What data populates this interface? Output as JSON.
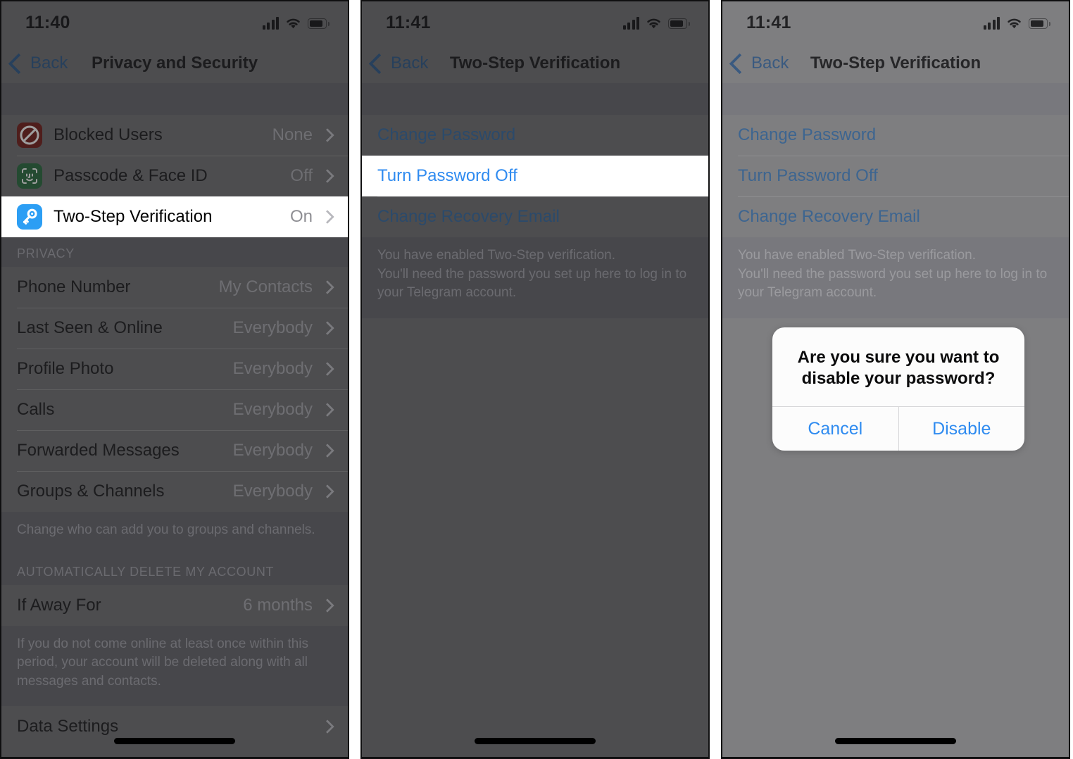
{
  "panels": [
    {
      "id": "privacy-and-security",
      "status_bar": {
        "time": "11:40",
        "cellular": "signal-bars-icon",
        "wifi": "wifi-icon",
        "battery": "battery-icon"
      },
      "nav": {
        "back_label": "Back",
        "title": "Privacy and Security"
      },
      "security_rows": [
        {
          "icon": "blocked-users-icon",
          "label": "Blocked Users",
          "value": "None"
        },
        {
          "icon": "face-id-icon",
          "label": "Passcode & Face ID",
          "value": "Off"
        },
        {
          "icon": "two-step-verification-key-icon",
          "label": "Two-Step Verification",
          "value": "On",
          "highlighted": true
        }
      ],
      "privacy_header": "PRIVACY",
      "privacy_rows": [
        {
          "label": "Phone Number",
          "value": "My Contacts"
        },
        {
          "label": "Last Seen & Online",
          "value": "Everybody"
        },
        {
          "label": "Profile Photo",
          "value": "Everybody"
        },
        {
          "label": "Calls",
          "value": "Everybody"
        },
        {
          "label": "Forwarded Messages",
          "value": "Everybody"
        },
        {
          "label": "Groups & Channels",
          "value": "Everybody"
        }
      ],
      "privacy_footer": "Change who can add you to groups and channels.",
      "delete_header": "AUTOMATICALLY DELETE MY ACCOUNT",
      "delete_rows": [
        {
          "label": "If Away For",
          "value": "6 months"
        }
      ],
      "delete_footer": "If you do not come online at least once within this period, your account will be deleted along with all messages and contacts.",
      "data_rows": [
        {
          "label": "Data Settings",
          "value": ""
        }
      ]
    },
    {
      "id": "two-step-verification",
      "status_bar": {
        "time": "11:41",
        "cellular": "signal-bars-icon",
        "wifi": "wifi-icon",
        "battery": "battery-icon"
      },
      "nav": {
        "back_label": "Back",
        "title": "Two-Step Verification"
      },
      "links": [
        {
          "label": "Change Password",
          "highlighted": false
        },
        {
          "label": "Turn Password Off",
          "highlighted": true
        },
        {
          "label": "Change Recovery Email",
          "highlighted": false
        }
      ],
      "footer": "You have enabled Two-Step verification.\nYou'll need the password you set up here to log in to your Telegram account."
    },
    {
      "id": "two-step-verification-confirm",
      "status_bar": {
        "time": "11:41",
        "cellular": "signal-bars-icon",
        "wifi": "wifi-icon",
        "battery": "battery-icon"
      },
      "nav": {
        "back_label": "Back",
        "title": "Two-Step Verification"
      },
      "links": [
        {
          "label": "Change Password",
          "highlighted": false
        },
        {
          "label": "Turn Password Off",
          "highlighted": false
        },
        {
          "label": "Change Recovery Email",
          "highlighted": false
        }
      ],
      "footer": "You have enabled Two-Step verification.\nYou'll need the password you set up here to log in to your Telegram account.",
      "alert": {
        "title": "Are you sure you want to disable your password?",
        "cancel_label": "Cancel",
        "confirm_label": "Disable"
      }
    }
  ],
  "colors": {
    "accent_blue": "#2f8bf0",
    "highlight_white": "#ffffff",
    "blocked_icon_red": "#b3231e",
    "face_id_icon_green": "#14843c",
    "key_icon_blue": "#2c9ef4",
    "dim_dark": "#4d4d4f",
    "dim_light": "#7e7e80"
  }
}
